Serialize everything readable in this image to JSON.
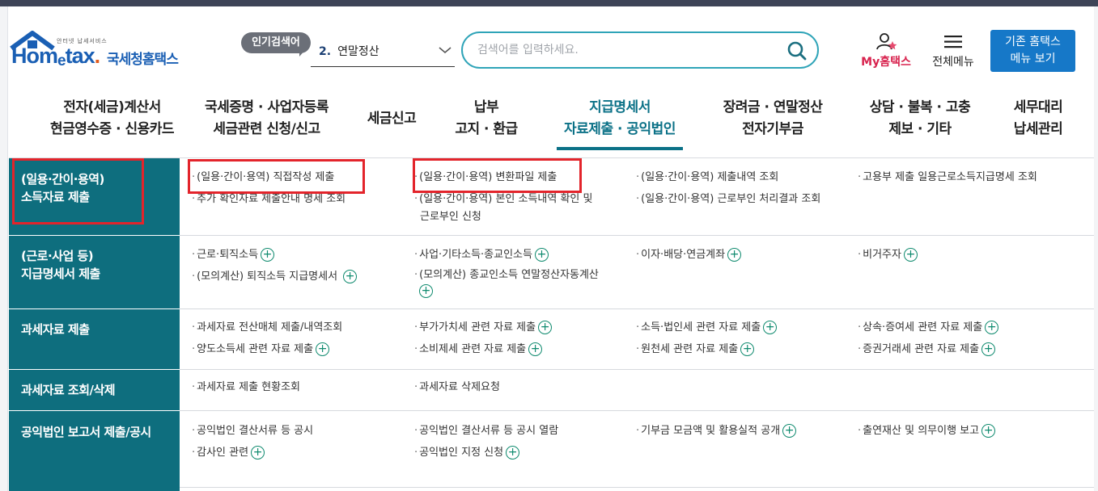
{
  "header": {
    "logo_small": "안터넷 납세서비스",
    "logo_home": "Hom",
    "logo_e": "e",
    "logo_tax": "tax",
    "logo_dot": ".",
    "logo_kor": "국세청홈택스",
    "popular_label": "인기검색어",
    "popular_rank": "2.",
    "popular_term": "연말정산",
    "search_placeholder": "검색어를 입력하세요.",
    "my_label": "My홈택스",
    "menu_label": "전체메뉴",
    "old_line1": "기존 홈택스",
    "old_line2": "메뉴 보기"
  },
  "nav": {
    "items": [
      {
        "line1": "전자(세금)계산서",
        "line2": "현금영수증 · 신용카드"
      },
      {
        "line1": "국세증명 · 사업자등록",
        "line2": "세금관련 신청/신고"
      },
      {
        "line1": "세금신고",
        "line2": ""
      },
      {
        "line1": "납부",
        "line2": "고지 · 환급"
      },
      {
        "line1": "지급명세서",
        "line2": "자료제출 · 공익법인"
      },
      {
        "line1": "장려금 · 연말정산",
        "line2": "전자기부금"
      },
      {
        "line1": "상담 · 불복 · 고충",
        "line2": "제보 · 기타"
      },
      {
        "line1": "세무대리",
        "line2": "납세관리"
      }
    ]
  },
  "menu": {
    "rows": [
      {
        "category": [
          "(일용·간이·용역)",
          "소득자료 제출"
        ],
        "links": [
          {
            "text": "(일용·간이·용역) 직접작성 제출",
            "plus": false
          },
          {
            "text": "추가 확인자료 제출안내 명세 조회",
            "plus": false
          },
          {
            "text": "(일용·간이·용역) 변환파일 제출",
            "plus": false
          },
          {
            "text": "(일용·간이·용역) 본인 소득내역 확인 및",
            "plus": false
          },
          {
            "text": "근로부인 신청",
            "plus": false
          },
          {
            "text": "(일용·간이·용역) 제출내역 조회",
            "plus": false
          },
          {
            "text": "(일용·간이·용역) 근로부인 처리결과 조회",
            "plus": false
          },
          {
            "text": "고용부 제출 일용근로소득지급명세 조회",
            "plus": false
          }
        ]
      },
      {
        "category": [
          "(근로·사업 등)",
          "지급명세서 제출"
        ],
        "links": [
          {
            "text": "근로·퇴직소득",
            "plus": true
          },
          {
            "text": "(모의계산) 퇴직소득 지급명세서",
            "plus": true
          },
          {
            "text": "사업·기타소득·종교인소득",
            "plus": true
          },
          {
            "text": "(모의계산) 종교인소득 연말정산자동계산",
            "plus": false
          },
          {
            "text": "이자·배당·연금계좌",
            "plus": true
          },
          {
            "text": "비거주자",
            "plus": true
          }
        ]
      },
      {
        "category": [
          "과세자료 제출"
        ],
        "links": [
          {
            "text": "과세자료 전산매체 제출/내역조회",
            "plus": false
          },
          {
            "text": "양도소득세 관련 자료 제출",
            "plus": true
          },
          {
            "text": "부가가치세 관련 자료 제출",
            "plus": true
          },
          {
            "text": "소비제세 관련 자료 제출",
            "plus": true
          },
          {
            "text": "소득·법인세 관련 자료 제출",
            "plus": true
          },
          {
            "text": "원천세 관련 자료 제출",
            "plus": true
          },
          {
            "text": "상속·증여세 관련 자료 제출",
            "plus": true
          },
          {
            "text": "증권거래세 관련 자료 제출",
            "plus": true
          }
        ]
      },
      {
        "category": [
          "과세자료 조회/삭제"
        ],
        "links": [
          {
            "text": "과세자료 제출 현황조회",
            "plus": false
          },
          {
            "text": "과세자료 삭제요청",
            "plus": false
          }
        ]
      },
      {
        "category": [
          "공익법인 보고서 제출/공시"
        ],
        "links": [
          {
            "text": "공익법인 결산서류 등 공시",
            "plus": false
          },
          {
            "text": "감사인 관련",
            "plus": true
          },
          {
            "text": "공익법인 결산서류 등 공시 열람",
            "plus": false
          },
          {
            "text": "공익법인 지정 신청",
            "plus": true
          },
          {
            "text": "기부금 모금액 및 활용실적 공개",
            "plus": true
          },
          {
            "text": "출연재산 및 의무이행 보고",
            "plus": true
          }
        ]
      }
    ]
  },
  "colors": {
    "teal": "#0e6e7e",
    "highlight": "#e3242b",
    "accent_blue": "#1678c8"
  }
}
